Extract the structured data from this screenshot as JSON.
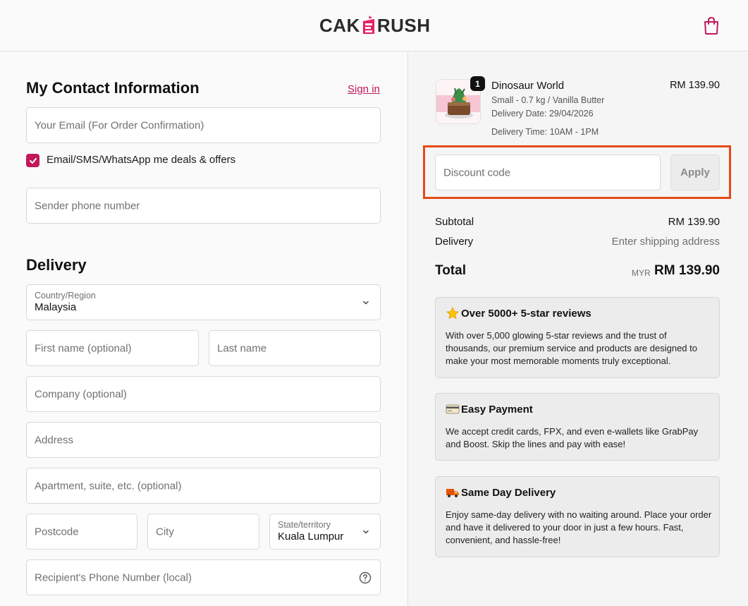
{
  "header": {
    "logo_left": "CAK",
    "logo_right": "RUSH"
  },
  "contact": {
    "title": "My Contact Information",
    "sign_in": "Sign in",
    "email_placeholder": "Your Email (For Order Confirmation)",
    "marketing_checkbox_label": "Email/SMS/WhatsApp me deals & offers",
    "marketing_checked": true,
    "phone_placeholder": "Sender phone number"
  },
  "delivery": {
    "title": "Delivery",
    "country_label": "Country/Region",
    "country_value": "Malaysia",
    "first_name_placeholder": "First name (optional)",
    "last_name_placeholder": "Last name",
    "company_placeholder": "Company (optional)",
    "address_placeholder": "Address",
    "apartment_placeholder": "Apartment, suite, etc. (optional)",
    "postcode_placeholder": "Postcode",
    "city_placeholder": "City",
    "state_label": "State/territory",
    "state_value": "Kuala Lumpur",
    "recipient_phone_placeholder": "Recipient's Phone Number (local)"
  },
  "order": {
    "item": {
      "quantity": "1",
      "name": "Dinosaur World",
      "variant": "Small - 0.7 kg / Vanilla Butter",
      "delivery_date": "Delivery Date: 29/04/2026",
      "delivery_time": "Delivery Time: 10AM - 1PM",
      "price": "RM 139.90"
    },
    "discount_placeholder": "Discount code",
    "apply_label": "Apply",
    "subtotal_label": "Subtotal",
    "subtotal_value": "RM 139.90",
    "delivery_label": "Delivery",
    "delivery_value": "Enter shipping address",
    "total_label": "Total",
    "total_currency": "MYR",
    "total_value": "RM 139.90"
  },
  "features": [
    {
      "icon": "star-icon",
      "title": "Over 5000+ 5-star reviews",
      "text": "With over 5,000 glowing 5-star reviews and the trust of thousands, our premium service and products are designed to make your most memorable moments truly exceptional."
    },
    {
      "icon": "credit-card-icon",
      "title": "Easy Payment",
      "text": "We accept credit cards, FPX, and even e-wallets like GrabPay and Boost. Skip the lines and pay with ease!"
    },
    {
      "icon": "delivery-truck-icon",
      "title": "Same Day Delivery",
      "text": "Enjoy same-day delivery with no waiting around. Place your order and have it delivered to your door in just a few hours. Fast, convenient, and hassle-free!"
    }
  ],
  "colors": {
    "brand": "#c2185b",
    "highlight": "#e64a19"
  }
}
